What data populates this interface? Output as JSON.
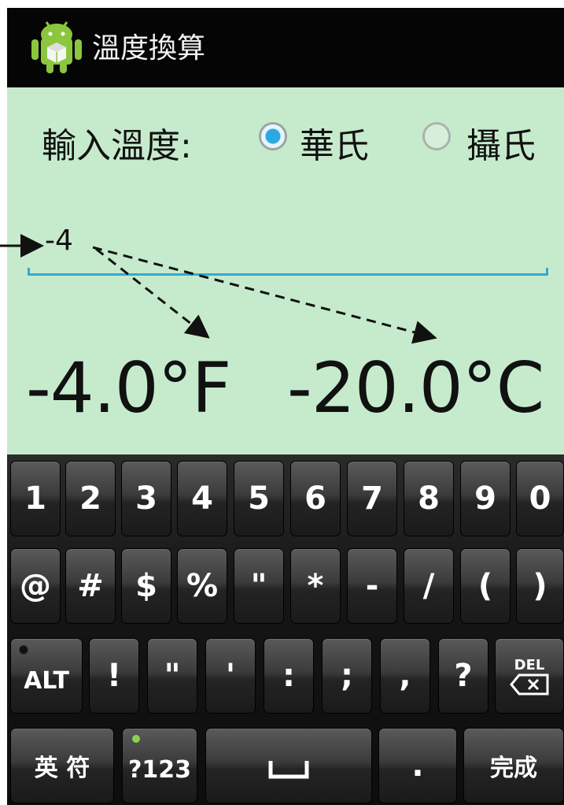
{
  "title_bar": {
    "app_title": "溫度換算"
  },
  "form": {
    "input_label": "輸入溫度:",
    "unit_options": [
      {
        "label": "華氏",
        "selected": true
      },
      {
        "label": "攝氏",
        "selected": false
      }
    ],
    "input_value": "-4",
    "accent_color": "#34a9d6"
  },
  "results": {
    "fahrenheit": "-4.0°F",
    "celsius": "-20.0°C"
  },
  "keyboard": {
    "row1": [
      "1",
      "2",
      "3",
      "4",
      "5",
      "6",
      "7",
      "8",
      "9",
      "0"
    ],
    "row2": [
      "@",
      "#",
      "$",
      "%",
      "\"",
      "*",
      "-",
      "/",
      "(",
      ")"
    ],
    "row3": [
      "ALT",
      "!",
      "\"",
      "'",
      ":",
      ";",
      ",",
      "?",
      "DEL"
    ],
    "row4": [
      "英 符",
      "?123",
      "space",
      ".",
      "完成"
    ]
  }
}
